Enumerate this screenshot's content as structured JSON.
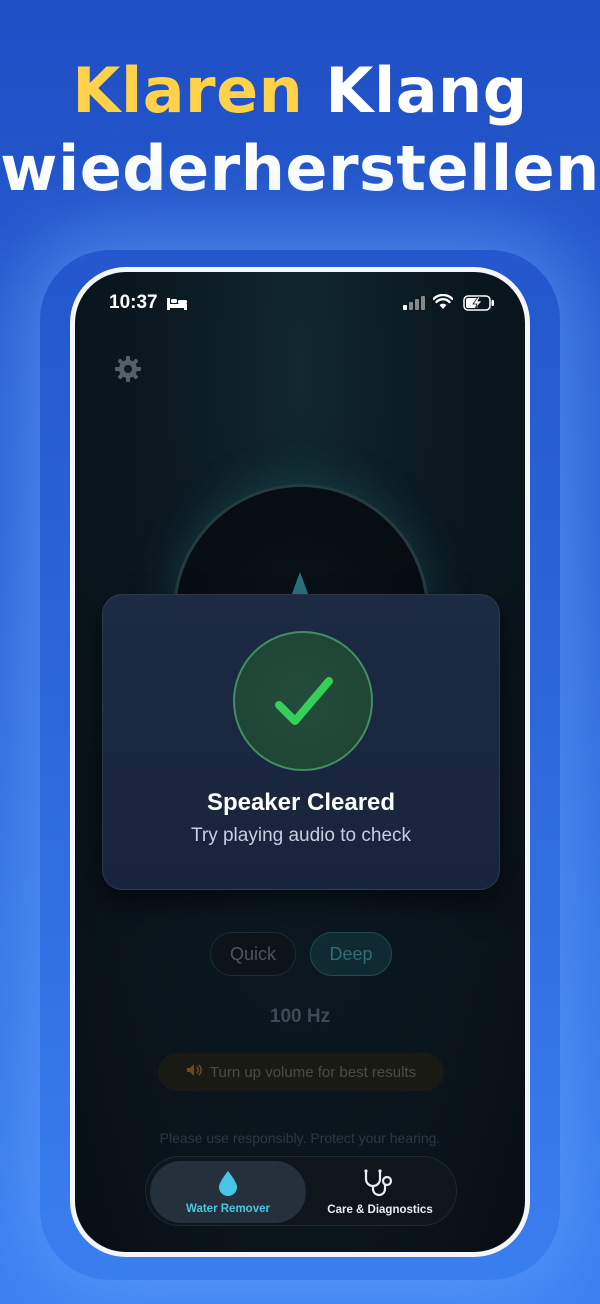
{
  "headline": {
    "accent_word": "Klaren",
    "line1_rest": "Klang",
    "line2": "wiederherstellen"
  },
  "status_bar": {
    "time": "10:37"
  },
  "modal": {
    "title": "Speaker Cleared",
    "subtitle": "Try playing audio to check"
  },
  "modes": {
    "quick_label": "Quick",
    "deep_label": "Deep",
    "selected": "Deep"
  },
  "frequency_label": "100 Hz",
  "hint_text": "Turn up volume for best results",
  "notice_text": "Please use responsibly. Protect your hearing.",
  "tabbar": {
    "tabs": [
      {
        "label": "Water Remover",
        "icon": "water-drop-icon",
        "active": true
      },
      {
        "label": "Care & Diagnostics",
        "icon": "stethoscope-icon",
        "active": false
      }
    ]
  },
  "colors": {
    "accent_yellow": "#ffd24a",
    "success_green": "#34d058",
    "tab_active_cyan": "#49c6e6"
  }
}
